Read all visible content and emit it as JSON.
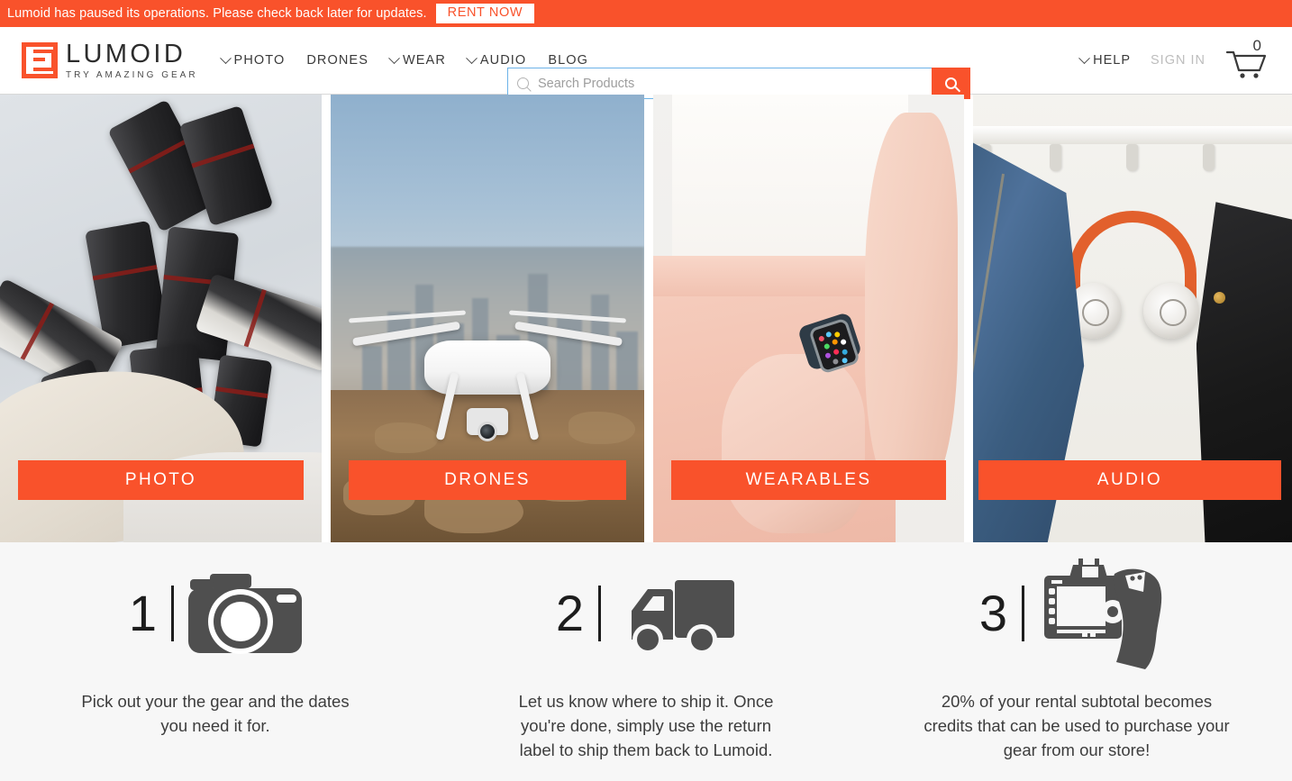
{
  "announcement": {
    "text": "Lumoid has paused its operations. Please check back later for updates.",
    "button_label": "RENT NOW",
    "bg_color": "#F9522B"
  },
  "header": {
    "logo": {
      "wordmark": "LUMOID",
      "tagline": "TRY AMAZING GEAR",
      "mark_color": "#F9522B"
    },
    "nav": [
      {
        "label": "PHOTO",
        "has_dropdown": true
      },
      {
        "label": "DRONES",
        "has_dropdown": false
      },
      {
        "label": "WEAR",
        "has_dropdown": true
      },
      {
        "label": "AUDIO",
        "has_dropdown": true
      },
      {
        "label": "BLOG",
        "has_dropdown": false
      }
    ],
    "search": {
      "placeholder": "Search Products",
      "value": "",
      "icon": "search-icon",
      "button_icon": "search-icon",
      "button_color": "#F9522B"
    },
    "help_label": "HELP",
    "signin_label": "SIGN IN",
    "cart": {
      "count": "0",
      "icon": "shopping-cart-icon"
    }
  },
  "categories": [
    {
      "label": "PHOTO",
      "image": "camera-lenses-photo",
      "button_color": "#F9522B"
    },
    {
      "label": "DRONES",
      "image": "drone-cityscape-photo",
      "button_color": "#F9522B"
    },
    {
      "label": "WEARABLES",
      "image": "smartwatch-on-wrist-photo",
      "button_color": "#F9522B"
    },
    {
      "label": "AUDIO",
      "image": "headphones-on-hook-photo",
      "button_color": "#F9522B"
    }
  ],
  "steps": [
    {
      "number": "1",
      "icon": "camera-icon",
      "text": "Pick out your the gear and the dates you need it for."
    },
    {
      "number": "2",
      "icon": "delivery-truck-icon",
      "text": "Let us know where to ship it. Once you're done, simply use the return label to ship them back to Lumoid."
    },
    {
      "number": "3",
      "icon": "hand-holding-camera-icon",
      "text": "20% of your rental subtotal becomes credits that can be used to purchase your gear from our store!"
    }
  ]
}
